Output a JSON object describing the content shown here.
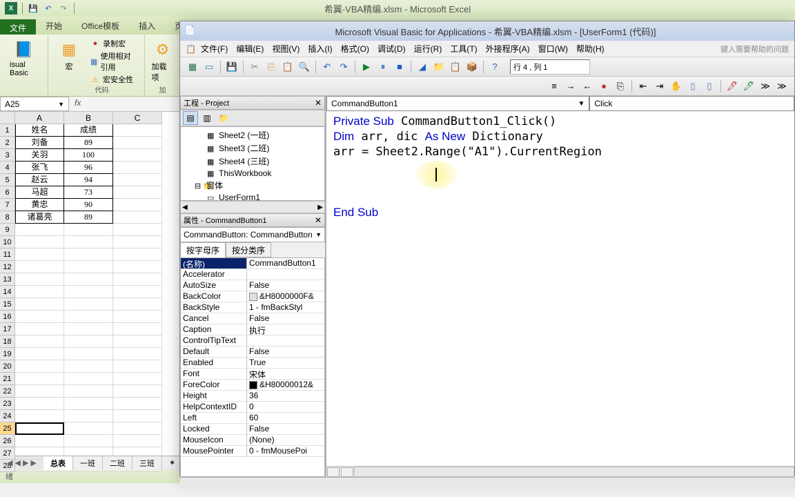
{
  "excel": {
    "title": "希翼-VBA精编.xlsm - Microsoft Excel",
    "tabs": {
      "file": "文件",
      "home": "开始",
      "office": "Office模板",
      "insert": "插入"
    },
    "ribbon": {
      "visual_basic": "isual Basic",
      "macro": "宏",
      "record": "录制宏",
      "relative": "使用相对引用",
      "security": "宏安全性",
      "addins": "加载项",
      "group_code": "代码",
      "group_add": "加"
    },
    "namebox": "A25",
    "columns": [
      "A",
      "B",
      "C"
    ],
    "table": {
      "headers": [
        "姓名",
        "成绩"
      ],
      "rows": [
        [
          "刘备",
          "89"
        ],
        [
          "关羽",
          "100"
        ],
        [
          "张飞",
          "96"
        ],
        [
          "赵云",
          "94"
        ],
        [
          "马超",
          "73"
        ],
        [
          "黄忠",
          "90"
        ],
        [
          "诸葛亮",
          "89"
        ]
      ]
    },
    "sheets": [
      "总表",
      "一班",
      "二班",
      "三班"
    ],
    "status": "绪"
  },
  "vba": {
    "title": "Microsoft Visual Basic for Applications - 希翼-VBA精编.xlsm - [UserForm1 (代码)]",
    "menu": [
      "文件(F)",
      "编辑(E)",
      "视图(V)",
      "插入(I)",
      "格式(O)",
      "调试(D)",
      "运行(R)",
      "工具(T)",
      "外接程序(A)",
      "窗口(W)",
      "帮助(H)"
    ],
    "help_hint": "键入需要帮助的问题",
    "position": "行 4 , 列 1",
    "project": {
      "title": "工程 - Project",
      "items": [
        {
          "label": "Sheet2 (一班)",
          "type": "sheet"
        },
        {
          "label": "Sheet3 (二班)",
          "type": "sheet"
        },
        {
          "label": "Sheet4 (三班)",
          "type": "sheet"
        },
        {
          "label": "ThisWorkbook",
          "type": "wb"
        },
        {
          "label": "窗体",
          "type": "folder"
        },
        {
          "label": "UserForm1",
          "type": "form"
        }
      ]
    },
    "properties": {
      "title": "属性 - CommandButton1",
      "combo": "CommandButton: CommandButton",
      "tabs": [
        "按字母序",
        "按分类序"
      ],
      "rows": [
        {
          "name": "(名称)",
          "val": "CommandButton1",
          "selected": true
        },
        {
          "name": "Accelerator",
          "val": ""
        },
        {
          "name": "AutoSize",
          "val": "False"
        },
        {
          "name": "BackColor",
          "val": "&H8000000F&",
          "swatch": "#e0e0e0"
        },
        {
          "name": "BackStyle",
          "val": "1 - fmBackStyl"
        },
        {
          "name": "Cancel",
          "val": "False"
        },
        {
          "name": "Caption",
          "val": "执行"
        },
        {
          "name": "ControlTipText",
          "val": ""
        },
        {
          "name": "Default",
          "val": "False"
        },
        {
          "name": "Enabled",
          "val": "True"
        },
        {
          "name": "Font",
          "val": "宋体"
        },
        {
          "name": "ForeColor",
          "val": "&H80000012&",
          "swatch": "#000000"
        },
        {
          "name": "Height",
          "val": "36"
        },
        {
          "name": "HelpContextID",
          "val": "0"
        },
        {
          "name": "Left",
          "val": "60"
        },
        {
          "name": "Locked",
          "val": "False"
        },
        {
          "name": "MouseIcon",
          "val": "(None)"
        },
        {
          "name": "MousePointer",
          "val": "0 - fmMousePoi"
        }
      ]
    },
    "code": {
      "object": "CommandButton1",
      "proc": "Click",
      "lines": [
        [
          {
            "t": "Private Sub",
            "c": "kw"
          },
          {
            "t": " CommandButton1_Click()"
          }
        ],
        [
          {
            "t": "Dim",
            "c": "kw"
          },
          {
            "t": " arr, dic "
          },
          {
            "t": "As New",
            "c": "kw"
          },
          {
            "t": " Dictionary"
          }
        ],
        [
          {
            "t": "arr = Sheet2.Range(\"A1\").CurrentRegion"
          }
        ],
        [
          {
            "t": ""
          }
        ],
        [
          {
            "t": ""
          }
        ],
        [
          {
            "t": ""
          }
        ],
        [
          {
            "t": "End Sub",
            "c": "kw"
          }
        ]
      ]
    }
  }
}
